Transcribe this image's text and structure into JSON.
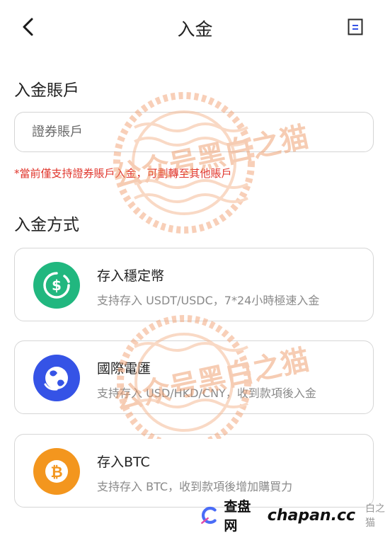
{
  "header": {
    "title": "入金"
  },
  "account_section": {
    "label": "入金賬戶",
    "input_placeholder": "證券賬戶",
    "note": "*當前僅支持證券賬戶入金，可劃轉至其他賬戶"
  },
  "method_section": {
    "label": "入金方式",
    "methods": [
      {
        "title": "存入穩定幣",
        "subtitle": "支持存入 USDT/USDC，7*24小時極速入金",
        "icon": "stablecoin-icon",
        "color": "#21b77f"
      },
      {
        "title": "國際電匯",
        "subtitle": "支持存入 USD/HKD/CNY，收到款項後入金",
        "icon": "globe-icon",
        "color": "#3553e6"
      },
      {
        "title": "存入BTC",
        "subtitle": "支持存入 BTC，收到款項後增加購買力",
        "icon": "bitcoin-icon",
        "color": "#f3961e"
      }
    ]
  },
  "watermark": {
    "text": "公众号黑白之猫"
  },
  "footer": {
    "site_name": "查盘网",
    "domain": "chapan.cc",
    "small_text": "白之猫"
  }
}
